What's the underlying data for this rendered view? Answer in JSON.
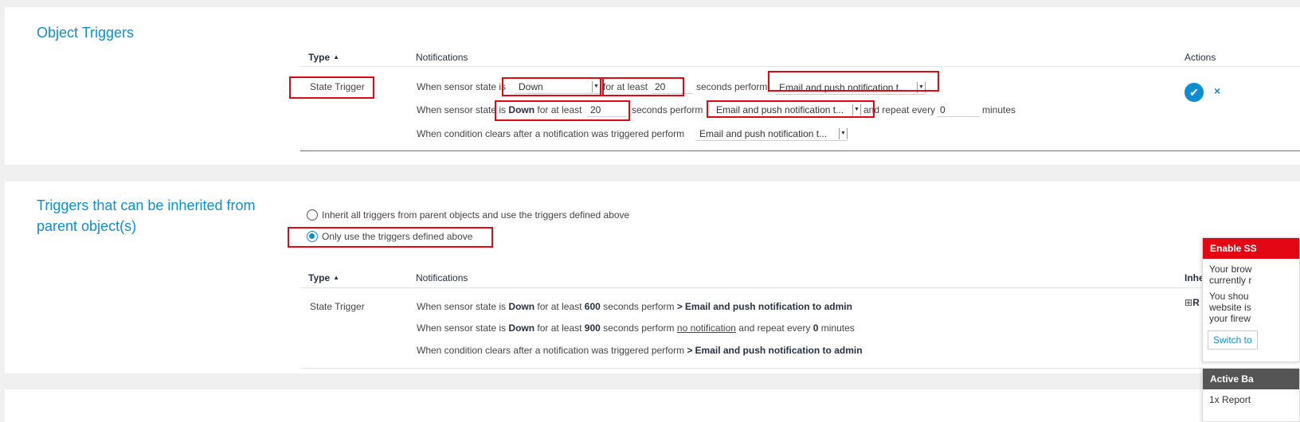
{
  "colors": {
    "accent": "#0b8fd0",
    "annotation": "#e30613",
    "danger_header": "#e30613",
    "dark_header": "#555555"
  },
  "object_triggers": {
    "title": "Object Triggers",
    "col_type": "Type",
    "col_notifications": "Notifications",
    "col_actions": "Actions",
    "row_type": "State Trigger",
    "line1": {
      "prefix": "When sensor state is",
      "state_value": "Down",
      "for_at_least": "for at least",
      "seconds_value": "20",
      "seconds_perform": "seconds perform",
      "action_value": "Email and push notification t..."
    },
    "line2": {
      "prefix": "When sensor state is",
      "state": "Down",
      "for_at_least": "for at least",
      "seconds_value": "20",
      "seconds_perform": "seconds perform",
      "action_value": "Email and push notification t...",
      "repeat": "and repeat every",
      "repeat_value": "0",
      "minutes": "minutes"
    },
    "line3": {
      "prefix": "When condition clears after a notification was triggered perform",
      "action_value": "Email and push notification t..."
    },
    "save_icon": "check-icon",
    "delete_icon": "close-icon"
  },
  "inherited": {
    "title": "Triggers that can be inherited from parent object(s)",
    "radio_inherit_all": "Inherit all triggers from parent objects and use the triggers defined above",
    "radio_only_above": "Only use the triggers defined above",
    "selected_radio": "only_above",
    "col_type": "Type",
    "col_notifications": "Notifications",
    "col_inherited": "Inhe",
    "row_type": "State Trigger",
    "line1": {
      "prefix": "When sensor state is",
      "state": "Down",
      "for_at_least": "for at least",
      "seconds": "600",
      "seconds_perform": "seconds perform",
      "chevron": ">",
      "action": "Email and push notification to admin"
    },
    "line2": {
      "prefix": "When sensor state is",
      "state": "Down",
      "for_at_least": "for at least",
      "seconds": "900",
      "seconds_perform": "seconds perform",
      "action_link": "no notification",
      "repeat": "and repeat every",
      "repeat_value": "0",
      "minutes": "minutes"
    },
    "line3": {
      "prefix": "When condition clears after a notification was triggered perform",
      "chevron": ">",
      "action": "Email and push notification to admin"
    },
    "inherited_link": "R"
  },
  "notifications": {
    "ssl": {
      "header": "Enable SS",
      "body_line1": "Your brow",
      "body_line2": "currently r",
      "body_line3": "You shou",
      "body_line4": "website is",
      "body_line5": "your firew",
      "button": "Switch to"
    },
    "active": {
      "header": "Active Ba",
      "body": "1x Report"
    }
  }
}
